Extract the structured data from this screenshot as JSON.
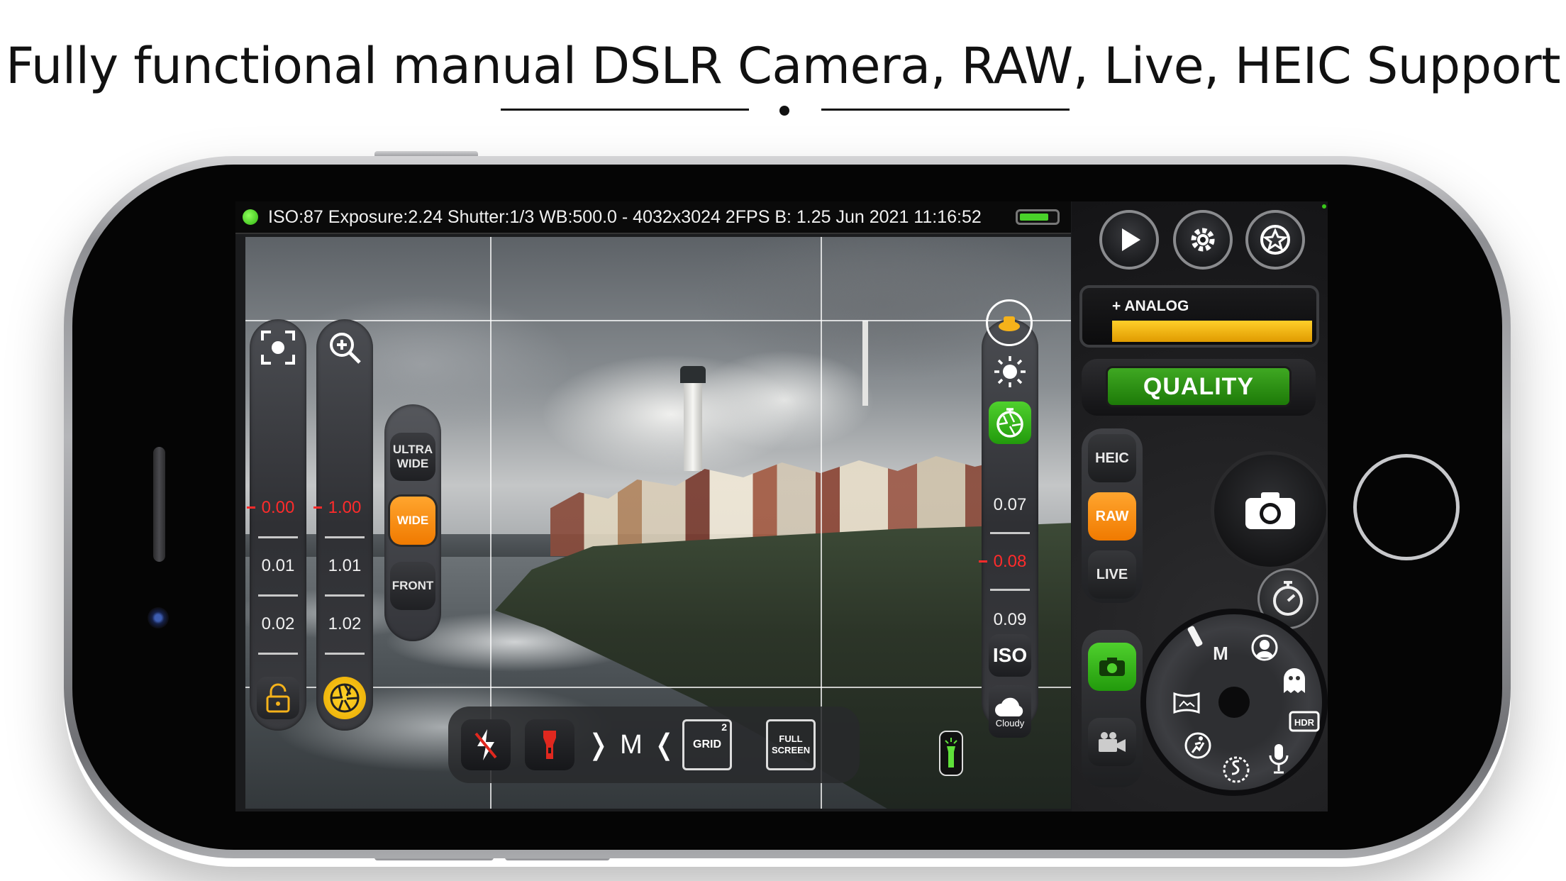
{
  "headline": "Fully functional manual DSLR Camera, RAW, Live, HEIC Support",
  "status_bar": {
    "text": "ISO:87 Exposure:2.24 Shutter:1/3 WB:500.0 - 4032x3024 2FPS B: 1.25  Jun 2021 11:16:52",
    "battery_level_percent": 80
  },
  "focus_slider": {
    "values": [
      "0.00",
      "0.01",
      "0.02"
    ],
    "active_index": 0
  },
  "zoom_slider": {
    "values": [
      "1.00",
      "1.01",
      "1.02"
    ],
    "active_index": 0
  },
  "lens": {
    "options": [
      "ULTRA WIDE",
      "WIDE",
      "FRONT"
    ],
    "selected": "WIDE"
  },
  "exposure_slider": {
    "values": [
      "0.07",
      "0.08",
      "0.09"
    ],
    "active_index": 1,
    "iso_label": "ISO",
    "wb_label": "Cloudy"
  },
  "toolbar": {
    "mode_label": "M",
    "grid_label": "GRID",
    "grid_count": "2",
    "fullscreen_label": "FULL SCREEN"
  },
  "analog": {
    "label": "+ ANALOG",
    "level_percent": 100
  },
  "quality": {
    "label": "QUALITY"
  },
  "format": {
    "options": [
      "HEIC",
      "RAW",
      "LIVE"
    ],
    "selected": "RAW"
  },
  "dial": {
    "mode_label": "M"
  },
  "colors": {
    "accent_orange": "#f07a00",
    "quality_green": "#2f9a16",
    "analog_yellow": "#f2b400",
    "status_green": "#49d12a"
  }
}
